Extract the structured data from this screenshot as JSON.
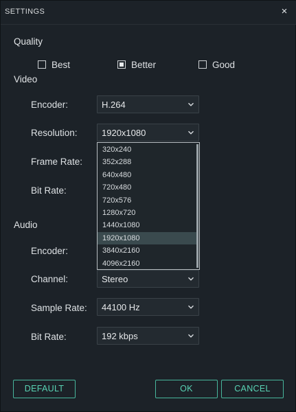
{
  "window": {
    "title": "SETTINGS",
    "close_glyph": "×"
  },
  "quality": {
    "heading": "Quality",
    "options": [
      {
        "label": "Best",
        "checked": false
      },
      {
        "label": "Better",
        "checked": true
      },
      {
        "label": "Good",
        "checked": false
      }
    ]
  },
  "video": {
    "heading": "Video",
    "encoder": {
      "label": "Encoder:",
      "value": "H.264"
    },
    "resolution": {
      "label": "Resolution:",
      "value": "1920x1080",
      "options": [
        "320x240",
        "352x288",
        "640x480",
        "720x480",
        "720x576",
        "1280x720",
        "1440x1080",
        "1920x1080",
        "3840x2160",
        "4096x2160"
      ],
      "selected_index": 7
    },
    "frame_rate": {
      "label": "Frame Rate:"
    },
    "bit_rate": {
      "label": "Bit Rate:"
    }
  },
  "audio": {
    "heading": "Audio",
    "encoder": {
      "label": "Encoder:"
    },
    "channel": {
      "label": "Channel:",
      "value": "Stereo"
    },
    "sample_rate": {
      "label": "Sample Rate:",
      "value": "44100 Hz"
    },
    "bit_rate": {
      "label": "Bit Rate:",
      "value": "192 kbps"
    }
  },
  "buttons": {
    "default": "DEFAULT",
    "ok": "OK",
    "cancel": "CANCEL"
  },
  "colors": {
    "accent": "#48b79d",
    "accent_text": "#59d3b4",
    "background": "#1c2228"
  }
}
